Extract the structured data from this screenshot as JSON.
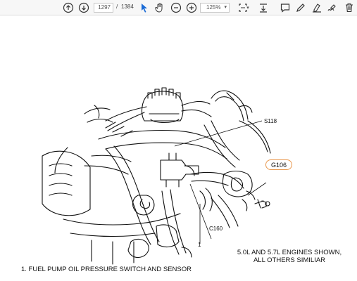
{
  "toolbar": {
    "page_current": "1297",
    "page_separator": "/",
    "page_total": "1384",
    "zoom": "125%",
    "icons": [
      "arrow-up-circle-icon",
      "arrow-down-circle-icon",
      "pointer-icon",
      "hand-icon",
      "zoom-out-icon",
      "zoom-in-icon",
      "fit-page-icon",
      "scroll-mode-icon",
      "comment-icon",
      "pen-icon",
      "highlight-icon",
      "sign-icon",
      "delete-icon"
    ]
  },
  "diagram": {
    "callouts": {
      "s118": "S118",
      "g106": "G106",
      "c160": "C160",
      "one": "1"
    },
    "note_line1": "5.0L AND 5.7L ENGINES SHOWN,",
    "note_line2": "ALL OTHERS SIMILIAR",
    "caption": "1.  FUEL PUMP OIL PRESSURE SWITCH AND SENSOR",
    "highlight_color": "#e8964a"
  }
}
